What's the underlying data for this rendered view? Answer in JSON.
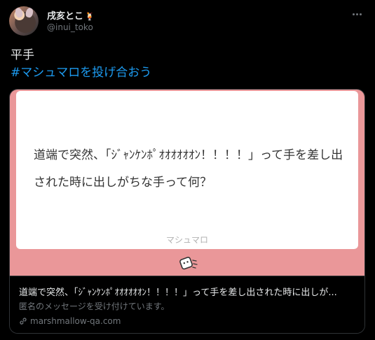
{
  "tweet": {
    "display_name": "戌亥とこ",
    "name_emoji": "🍹",
    "handle": "@inui_toko",
    "text": "平手",
    "hashtag": "#マシュマロを投げ合おう"
  },
  "card": {
    "question": "道端で突然、「ｼﾞｬﾝｹﾝﾎﾟｵｵｵｵｵｵﾝ！！！！」って手を差し出された時に出しがちな手って何？",
    "brand": "マシュマロ",
    "title": "道端で突然、「ｼﾞｬﾝｹﾝﾎﾟｵｵｵｵｵｵﾝ！！！！」って手を差し出された時に出しが...",
    "description": "匿名のメッセージを受け付けています。",
    "domain": "marshmallow-qa.com"
  },
  "colors": {
    "background": "#000000",
    "link": "#1d9bf0",
    "card_bg": "#ea9799"
  }
}
